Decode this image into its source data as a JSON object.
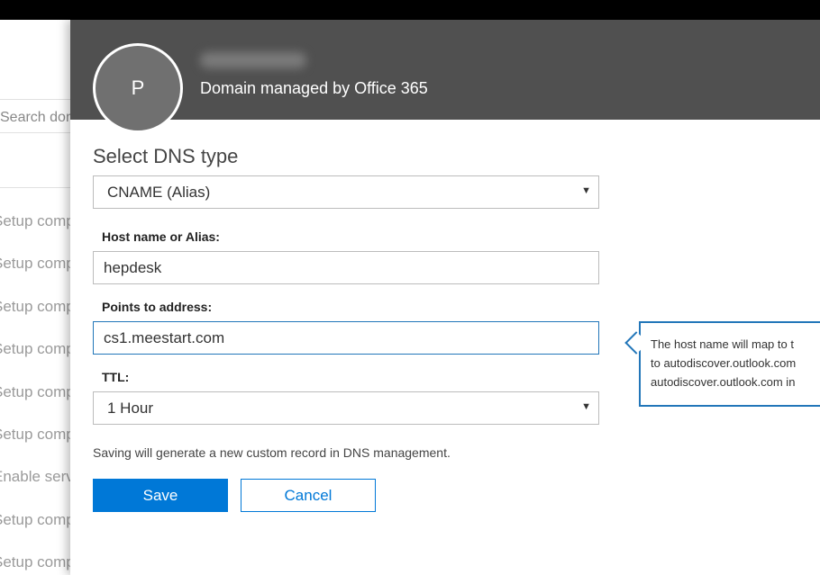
{
  "background": {
    "search_placeholder": "Search domains",
    "statuses": [
      "Setup complete",
      "Setup complete",
      "Setup complete",
      "Setup complete",
      "Setup complete",
      "Setup complete",
      "Enable services",
      "Setup complete",
      "Setup complete"
    ]
  },
  "panel": {
    "avatar_letter": "P",
    "subtitle": "Domain managed by Office 365",
    "dns_type": {
      "title": "Select DNS type",
      "selected": "CNAME (Alias)"
    },
    "host": {
      "label": "Host name or Alias:",
      "value": "hepdesk"
    },
    "points_to": {
      "label": "Points to address:",
      "value": "cs1.meestart.com"
    },
    "ttl": {
      "label": "TTL:",
      "selected": "1 Hour"
    },
    "note": "Saving will generate a new custom record in DNS management.",
    "save_label": "Save",
    "cancel_label": "Cancel"
  },
  "callout": {
    "lines": [
      "The host name will map to t",
      "to autodiscover.outlook.com",
      "autodiscover.outlook.com in"
    ]
  },
  "colors": {
    "header_bg": "#505050",
    "accent": "#0078d7",
    "focus_border": "#2276b9"
  }
}
